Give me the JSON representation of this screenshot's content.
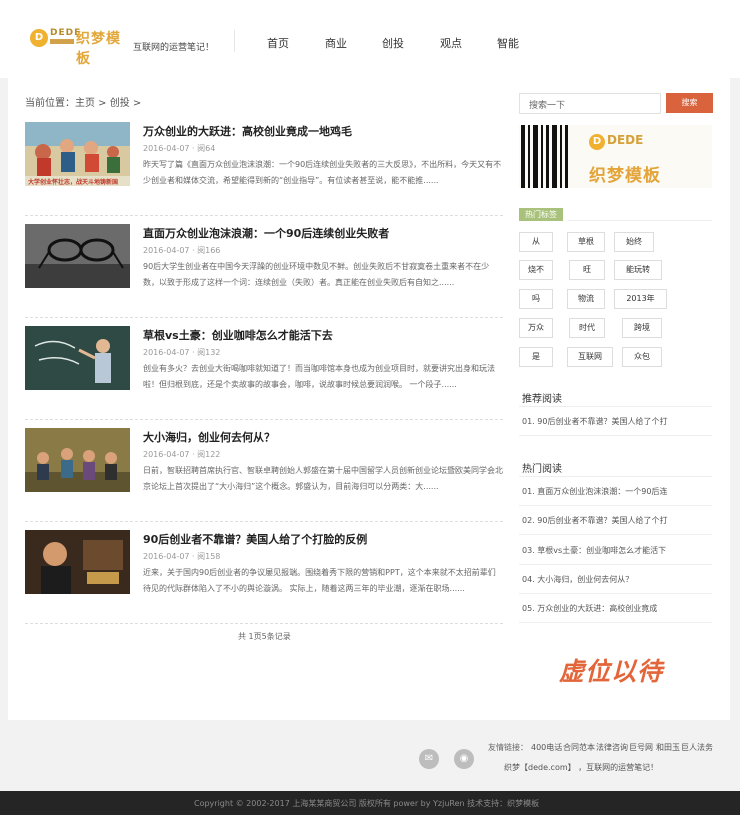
{
  "header": {
    "logo_text": "织梦模板",
    "slogan": "互联网的运营笔记！",
    "nav": [
      "首页",
      "商业",
      "创投",
      "观点",
      "智能"
    ]
  },
  "breadcrumb": "当前位置：主页 > 创投 >",
  "articles": [
    {
      "title": "万众创业的大跃进：高校创业竟成一地鸡毛",
      "meta": "2016-04-07 · 阅64",
      "summary": "昨天写了篇《直面万众创业泡沫浪潮：一个90后连续创业失败者的三大反思》，不出所料，今天又有不少创业者和媒体交流，希望能得到新的“创业指导”。有位读者甚至说，能不能推......",
      "image_caption": "大学创业怀壮志，战天斗地铸新国"
    },
    {
      "title": "直面万众创业泡沫浪潮：一个90后连续创业失败者",
      "meta": "2016-04-07 · 阅166",
      "summary": "90后大学生创业者在中国今天浮躁的创业环境中数见不鲜。创业失败后不甘寂寞卷土重来者不在少数，以致于形成了这样一个词：连续创业（失败）者。真正能在创业失败后有自知之......"
    },
    {
      "title": "草根vs土豪：创业咖啡怎么才能活下去",
      "meta": "2016-04-07 · 阅132",
      "summary": "创业有多火？去创业大街喝咖啡就知道了！而当咖啡馆本身也成为创业项目时，就要讲究出身和玩法啦！但归根到底，还是个卖故事的故事会，咖啡，说故事时候总要润润喉。 一个段子......"
    },
    {
      "title": "大小海归，创业何去何从？",
      "meta": "2016-04-07 · 阅122",
      "summary": "日前，智联招聘首席执行官、智联卓聘创始人郭盛在第十届中国留学人员创新创业论坛暨欧美同学会北京论坛上首次提出了“大小海归”这个概念。郭盛认为，目前海归可以分两类：大......"
    },
    {
      "title": "90后创业者不靠谱？美国人给了个打脸的反例",
      "meta": "2016-04-07 · 阅158",
      "summary": "近来，关于国内90后创业者的争议屡见报端。围绕着秀下限的营销和PPT，这个本来就不太招前辈们待见的代际群体陷入了不小的舆论漩涡。 实际上，随着这两三年的毕业潮，逐渐在职场......"
    }
  ],
  "pagination": "共 1页5条记录",
  "sidebar": {
    "search_placeholder": "搜索一下",
    "search_button": "搜索",
    "ad": {
      "brand": "DEDE",
      "text": "织梦模板"
    },
    "tags_title": "热门标签",
    "tags": [
      "从",
      "草根",
      "始终",
      "烧不",
      "旺",
      "能玩转",
      "吗",
      "物流",
      "2013年",
      "万众",
      "时代",
      "跨境",
      "是",
      "互联网",
      "众包"
    ],
    "recommended_title": "推荐阅读",
    "recommended": [
      "01. 90后创业者不靠谱？美国人给了个打"
    ],
    "hot_title": "热门阅读",
    "hot": [
      "01. 直面万众创业泡沫浪潮：一个90后连",
      "02. 90后创业者不靠谱？美国人给了个打",
      "03. 草根vs土豪：创业咖啡怎么才能活下",
      "04. 大小海归，创业何去何从？",
      "05. 万众创业的大跃进：高校创业竟成"
    ],
    "promo": "虚位以待"
  },
  "footer": {
    "links_label": "友情链接：",
    "links": [
      "400电话",
      "合同范本",
      "法律咨询",
      "巨号网",
      "和田玉",
      "巨人法务"
    ],
    "line2": "织梦【dede.com】 ，互联网的运营笔记！",
    "copyright": "Copyright © 2002-2017 上海某某商贸公司 版权所有 power by YzjuRen    技术支持：织梦模板"
  },
  "colors": {
    "accent": "#d9633d",
    "tag_head": "#a9c27b",
    "logo": "#e2a73a",
    "footer_bg": "#252525"
  }
}
